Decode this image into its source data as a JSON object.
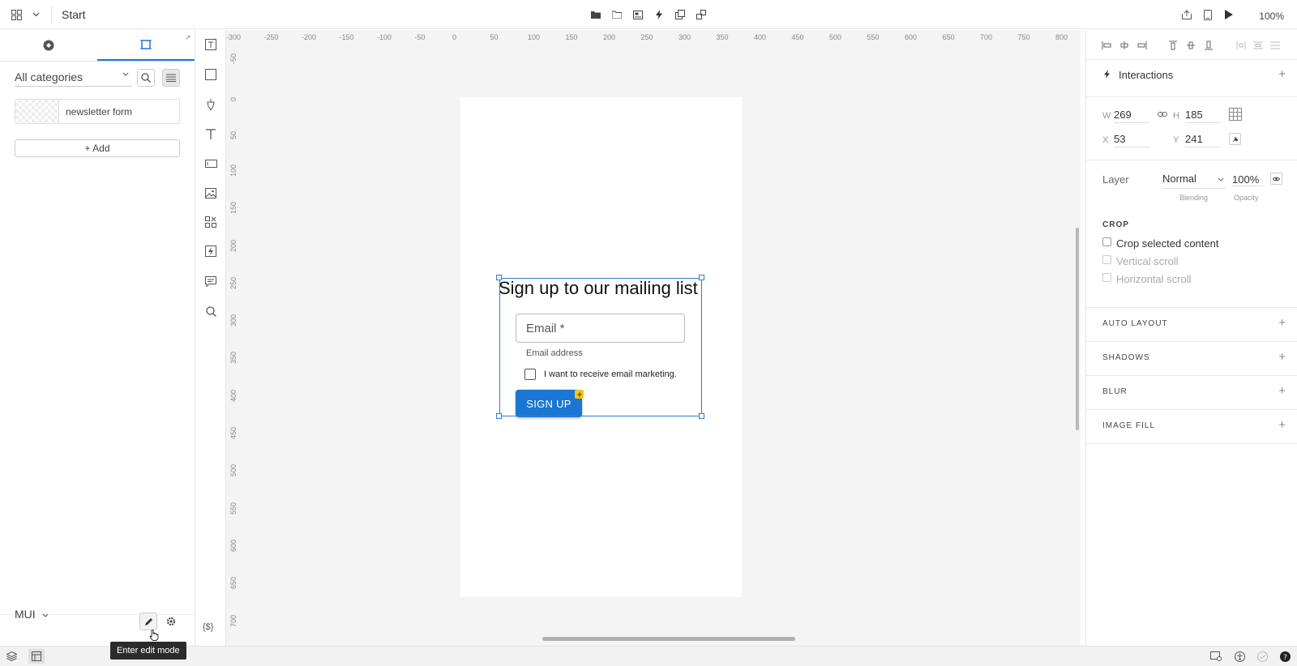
{
  "topbar": {
    "title": "Start",
    "zoom": "100%",
    "icons_left": [
      "grid-icon",
      "chevron-down-icon"
    ],
    "icons_center": [
      "folder-icon",
      "image-folder-icon",
      "gallery-icon",
      "lightning-icon",
      "copy-icon",
      "link-icon"
    ],
    "icons_right": [
      "export-icon",
      "device-icon",
      "play-icon"
    ]
  },
  "left_panel": {
    "tabs": [
      {
        "icon": "components-icon"
      },
      {
        "icon": "frame-icon"
      }
    ],
    "category_select": "All categories",
    "component_name": "newsletter form",
    "add_label": "+ Add",
    "library_select": "MUI",
    "tooltip": "Enter edit mode"
  },
  "tools": [
    "text-box-tool",
    "rectangle-tool",
    "pen-tool",
    "text-tool",
    "input-tool",
    "image-tool",
    "components-tool",
    "interaction-tool",
    "comment-tool",
    "search-tool"
  ],
  "variables_label": "{$}",
  "rulers": {
    "h": [
      "-300",
      "-250",
      "-200",
      "-150",
      "-100",
      "-50",
      "0",
      "50",
      "100",
      "150",
      "200",
      "250",
      "300",
      "350",
      "400",
      "450",
      "500",
      "550",
      "600",
      "650",
      "700",
      "750",
      "800"
    ],
    "v": [
      "-50",
      "0",
      "50",
      "100",
      "150",
      "200",
      "250",
      "300",
      "350",
      "400",
      "450",
      "500",
      "550",
      "600",
      "650",
      "700"
    ]
  },
  "form": {
    "title": "Sign up to our mailing list",
    "email_label": "Email *",
    "email_helper": "Email address",
    "checkbox_label": "I want to receive email marketing.",
    "button_label": "SIGN UP"
  },
  "right_panel": {
    "interactions_title": "Interactions",
    "w_label": "W",
    "w_value": "269",
    "h_label": "H",
    "h_value": "185",
    "x_label": "X",
    "x_value": "53",
    "y_label": "Y",
    "y_value": "241",
    "layer_label": "Layer",
    "blending_value": "Normal",
    "blending_caption": "Blending",
    "opacity_value": "100%",
    "opacity_caption": "Opacity",
    "crop_title": "CROP",
    "crop_options": [
      "Crop selected content",
      "Vertical scroll",
      "Horizontal scroll"
    ],
    "sections": [
      "AUTO LAYOUT",
      "SHADOWS",
      "BLUR",
      "IMAGE FILL"
    ]
  },
  "colors": {
    "accent": "#1a73e8",
    "button": "#1976d2",
    "selection": "#2f7bd7",
    "badge": "#f5c518"
  }
}
